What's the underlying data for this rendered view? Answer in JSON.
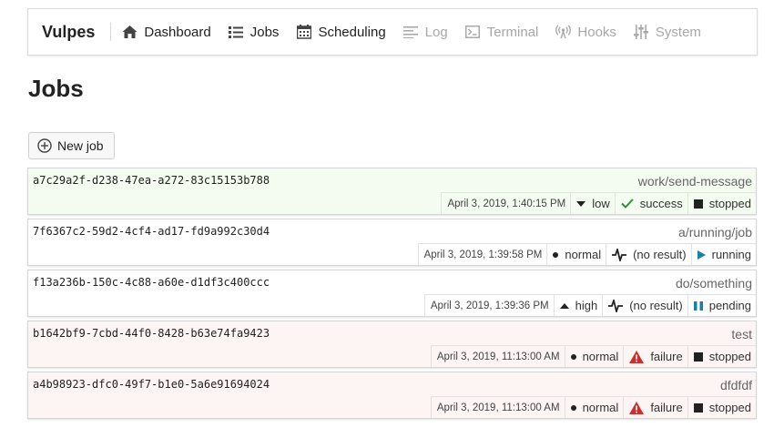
{
  "app": {
    "brand": "Vulpes"
  },
  "nav": [
    {
      "label": "Dashboard",
      "icon": "home-icon",
      "enabled": true
    },
    {
      "label": "Jobs",
      "icon": "list-icon",
      "enabled": true
    },
    {
      "label": "Scheduling",
      "icon": "calendar-icon",
      "enabled": true
    },
    {
      "label": "Log",
      "icon": "log-icon",
      "enabled": false
    },
    {
      "label": "Terminal",
      "icon": "terminal-icon",
      "enabled": false
    },
    {
      "label": "Hooks",
      "icon": "broadcast-icon",
      "enabled": false
    },
    {
      "label": "System",
      "icon": "sliders-icon",
      "enabled": false
    }
  ],
  "page": {
    "title": "Jobs"
  },
  "actions": {
    "new_job_label": "New job"
  },
  "colors": {
    "success_row_bg": "#f4fbf1",
    "failure_row_bg": "#fdf4f4",
    "success_green": "#2e8b3a",
    "failure_red": "#c9302c",
    "running_blue": "#1a7fa8",
    "pending_blue": "#1a7fa8"
  },
  "jobs": [
    {
      "id": "a7c29a2f-d238-47ea-a272-83c15153b788",
      "name": "work/send-message",
      "date": "April 3, 2019, 1:40:15 PM",
      "priority": "low",
      "priority_icon": "caret-down-icon",
      "result": "success",
      "result_icon": "check-icon",
      "status": "stopped",
      "status_icon": "stop-icon",
      "row_state": "success"
    },
    {
      "id": "7f6367c2-59d2-4cf4-ad17-fd9a992c30d4",
      "name": "a/running/job",
      "date": "April 3, 2019, 1:39:58 PM",
      "priority": "normal",
      "priority_icon": "dot-icon",
      "result": "(no result)",
      "result_icon": "heartbeat-icon",
      "status": "running",
      "status_icon": "play-icon",
      "row_state": "none"
    },
    {
      "id": "f13a236b-150c-4c88-a60e-d1df3c400ccc",
      "name": "do/something",
      "date": "April 3, 2019, 1:39:36 PM",
      "priority": "high",
      "priority_icon": "caret-up-icon",
      "result": "(no result)",
      "result_icon": "heartbeat-icon",
      "status": "pending",
      "status_icon": "pause-icon",
      "row_state": "none"
    },
    {
      "id": "b1642bf9-7cbd-44f0-8428-b63e74fa9423",
      "name": "test",
      "date": "April 3, 2019, 11:13:00 AM",
      "priority": "normal",
      "priority_icon": "dot-icon",
      "result": "failure",
      "result_icon": "warning-icon",
      "status": "stopped",
      "status_icon": "stop-icon",
      "row_state": "failure"
    },
    {
      "id": "a4b98923-dfc0-49f7-b1e0-5a6e91694024",
      "name": "dfdfdf",
      "date": "April 3, 2019, 11:13:00 AM",
      "priority": "normal",
      "priority_icon": "dot-icon",
      "result": "failure",
      "result_icon": "warning-icon",
      "status": "stopped",
      "status_icon": "stop-icon",
      "row_state": "failure"
    }
  ]
}
